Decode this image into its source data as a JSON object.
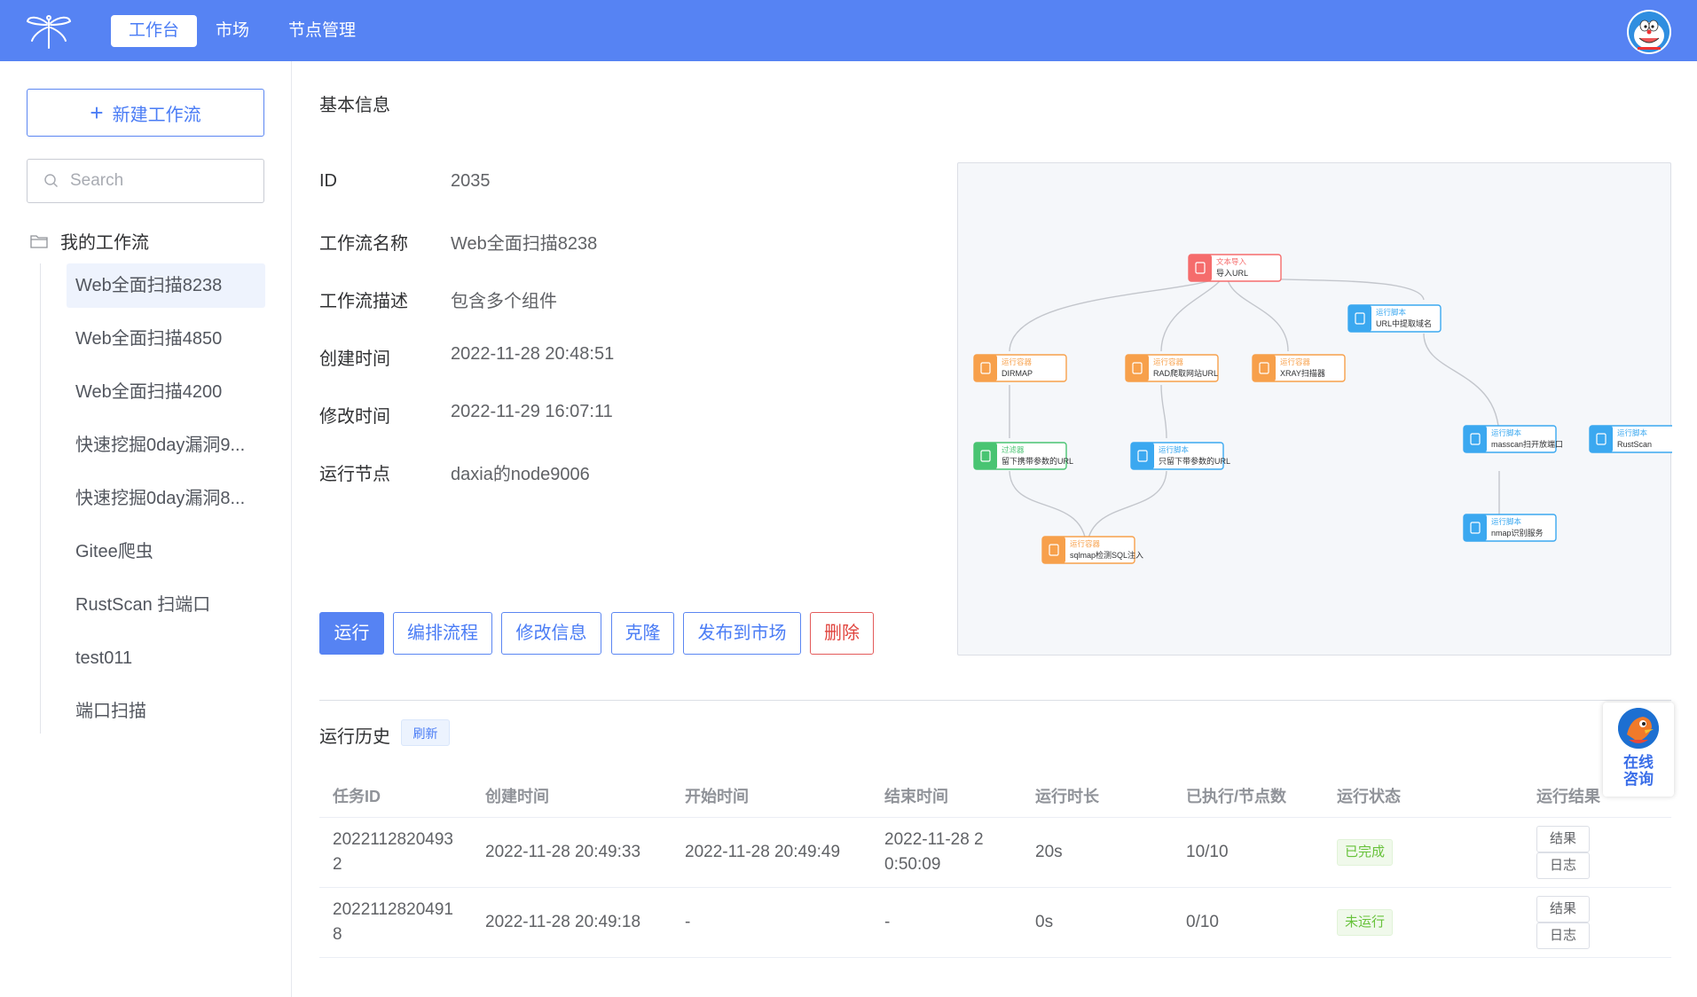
{
  "nav": {
    "items": [
      "工作台",
      "市场",
      "节点管理"
    ],
    "active_index": 0
  },
  "sidebar": {
    "new_button": "新建工作流",
    "search_placeholder": "Search",
    "folder": "我的工作流",
    "items": [
      "Web全面扫描8238",
      "Web全面扫描4850",
      "Web全面扫描4200",
      "快速挖掘0day漏洞9...",
      "快速挖掘0day漏洞8...",
      "Gitee爬虫",
      "RustScan 扫端口",
      "test011",
      "端口扫描"
    ],
    "active_index": 0
  },
  "basic_info": {
    "title": "基本信息",
    "rows": [
      {
        "label": "ID",
        "value": "2035"
      },
      {
        "label": "工作流名称",
        "value": "Web全面扫描8238"
      },
      {
        "label": "工作流描述",
        "value": "包含多个组件"
      },
      {
        "label": "创建时间",
        "value": "2022-11-28 20:48:51"
      },
      {
        "label": "修改时间",
        "value": "2022-11-29 16:07:11"
      },
      {
        "label": "运行节点",
        "value": "daxia的node9006"
      }
    ]
  },
  "actions": {
    "run": "运行",
    "edit_flow": "编排流程",
    "edit_info": "修改信息",
    "clone": "克隆",
    "publish": "发布到市场",
    "delete": "删除"
  },
  "flow": {
    "nodes": [
      {
        "type": "文本导入",
        "name": "导入URL",
        "color": "#f56c6c"
      },
      {
        "type": "运行脚本",
        "name": "URL中提取域名",
        "color": "#3ba8f0"
      },
      {
        "type": "运行容器",
        "name": "DIRMAP",
        "color": "#f7a04b"
      },
      {
        "type": "运行容器",
        "name": "RAD爬取网站URL",
        "color": "#f7a04b"
      },
      {
        "type": "运行容器",
        "name": "XRAY扫描器",
        "color": "#f7a04b"
      },
      {
        "type": "过滤器",
        "name": "留下携带参数的URL",
        "color": "#49c472"
      },
      {
        "type": "运行脚本",
        "name": "只留下带参数的URL",
        "color": "#3ba8f0"
      },
      {
        "type": "运行脚本",
        "name": "masscan扫开放端口",
        "color": "#3ba8f0"
      },
      {
        "type": "运行脚本",
        "name": "RustScan",
        "color": "#3ba8f0"
      },
      {
        "type": "运行脚本",
        "name": "nmap识别服务",
        "color": "#3ba8f0"
      },
      {
        "type": "运行容器",
        "name": "sqlmap检测SQL注入",
        "color": "#f7a04b"
      }
    ]
  },
  "history": {
    "title": "运行历史",
    "refresh": "刷新",
    "columns": [
      "任务ID",
      "创建时间",
      "开始时间",
      "结束时间",
      "运行时长",
      "已执行/节点数",
      "运行状态",
      "运行结果"
    ],
    "rows": [
      {
        "id": "20221128204932",
        "created": "2022-11-28 20:49:33",
        "start": "2022-11-28 20:49:49",
        "end": "2022-11-28 20:50:09",
        "duration": "20s",
        "progress": "10/10",
        "status": "已完成",
        "result": "结果",
        "log": "日志"
      },
      {
        "id": "20221128204918",
        "created": "2022-11-28 20:49:18",
        "start": "-",
        "end": "-",
        "duration": "0s",
        "progress": "0/10",
        "status": "未运行",
        "result": "结果",
        "log": "日志"
      }
    ]
  },
  "consult": {
    "line1": "在线",
    "line2": "咨询"
  }
}
